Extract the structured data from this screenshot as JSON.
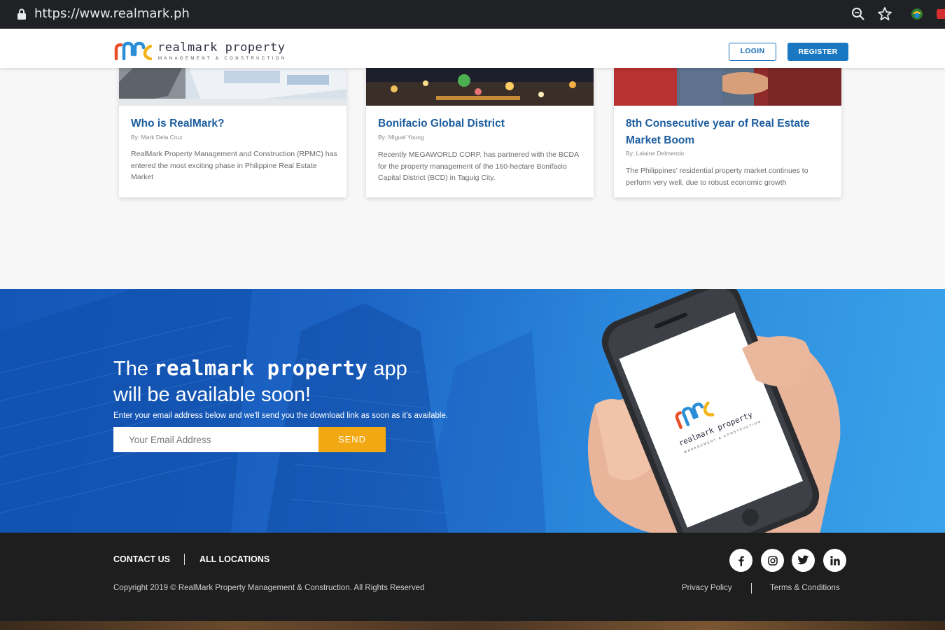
{
  "browser": {
    "url": "https://www.realmark.ph"
  },
  "header": {
    "brand_name": "realmark property",
    "brand_tagline": "MANAGEMENT & CONSTRUCTION",
    "login_label": "LOGIN",
    "register_label": "REGISTER"
  },
  "articles": [
    {
      "title": "Who is RealMark?",
      "author": "By: Mark Dela Cruz",
      "excerpt": "RealMark Property Management and Construction (RPMC) has entered the most exciting phase in Philippine Real Estate Market"
    },
    {
      "title": "Bonifacio Global District",
      "author": "By: Miguel Young",
      "excerpt": "Recently MEGAWORLD CORP. has partnered with the BCDA for the property management of the 160-hectare Bonifacio Capital District (BCD) in Taguig City."
    },
    {
      "title": "8th Consecutive year of Real Estate Market Boom",
      "author": "By: Lalaine Delmendo",
      "excerpt": "The Philippines' residential property market continues to perform very well, due to robust economic growth"
    }
  ],
  "app_promo": {
    "heading_prefix": "The",
    "heading_brand": "realmark property",
    "heading_suffix": "app",
    "heading_line2": "will be available soon!",
    "subtext": "Enter your email address below and we'll send you the download link as soon as it's available.",
    "email_placeholder": "Your Email Address",
    "send_label": "SEND",
    "phone_brand": "realmark property",
    "phone_tagline": "MANAGEMENT & CONSTRUCTION"
  },
  "footer": {
    "contact_label": "CONTACT US",
    "locations_label": "ALL LOCATIONS",
    "copyright": "Copyright 2019 © RealMark Property Management & Construction. All Rights Reserved",
    "privacy_label": "Privacy Policy",
    "terms_label": "Terms & Conditions",
    "social": [
      "facebook-icon",
      "instagram-icon",
      "twitter-icon",
      "linkedin-icon"
    ]
  },
  "colors": {
    "brand_blue": "#1a78c2",
    "title_blue": "#1c5d9f",
    "send_orange": "#f2a812",
    "footer_bg": "#1e1e1e"
  }
}
